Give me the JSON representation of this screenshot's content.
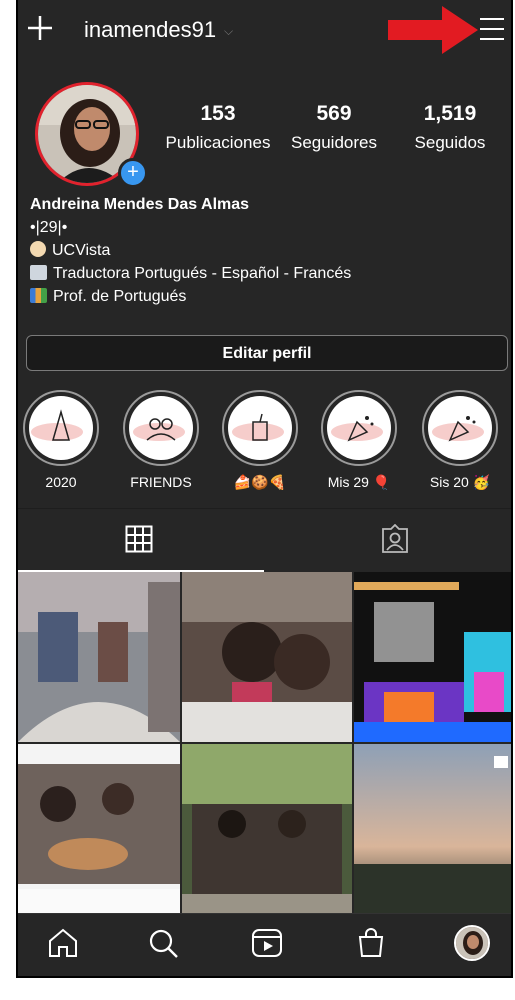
{
  "header": {
    "username": "inamendes91",
    "new_post_icon": "plus-icon",
    "menu_icon": "hamburger-menu-icon",
    "annotation_arrow_color": "#e21b22"
  },
  "profile": {
    "avatar_ring_color": "#e1222d",
    "add_story_icon": "plus-circle-icon",
    "stats": [
      {
        "value": "153",
        "label": "Publicaciones"
      },
      {
        "value": "569",
        "label": "Seguidores"
      },
      {
        "value": "1,519",
        "label": "Seguidos"
      }
    ],
    "name": "Andreina Mendes Das Almas",
    "bio_lines": [
      {
        "icon": "",
        "text": "•|29|•"
      },
      {
        "icon": "student-emoji",
        "text": "UCVista"
      },
      {
        "icon": "computer-emoji",
        "text": "Traductora Portugués - Español - Francés"
      },
      {
        "icon": "books-emoji",
        "text": "Prof. de Portugués"
      }
    ],
    "edit_button": "Editar perfil"
  },
  "highlights": [
    {
      "label": "2020",
      "icon": "party-hat-icon"
    },
    {
      "label": "FRIENDS",
      "icon": "friends-icon"
    },
    {
      "label": "🍰🍪🍕",
      "icon": "drink-icon"
    },
    {
      "label": "Mis 29 🎈",
      "icon": "confetti-icon"
    },
    {
      "label": "Sis 20 🥳",
      "icon": "confetti-icon"
    }
  ],
  "tabs": [
    {
      "name": "grid-tab",
      "icon": "grid-icon",
      "active": true
    },
    {
      "name": "tagged-tab",
      "icon": "tagged-person-icon",
      "active": false
    }
  ],
  "bottom_nav": [
    {
      "name": "home",
      "icon": "home-icon"
    },
    {
      "name": "search",
      "icon": "search-icon"
    },
    {
      "name": "reels",
      "icon": "reels-icon"
    },
    {
      "name": "shop",
      "icon": "shopping-bag-icon"
    },
    {
      "name": "profile",
      "icon": "profile-avatar-icon"
    }
  ]
}
